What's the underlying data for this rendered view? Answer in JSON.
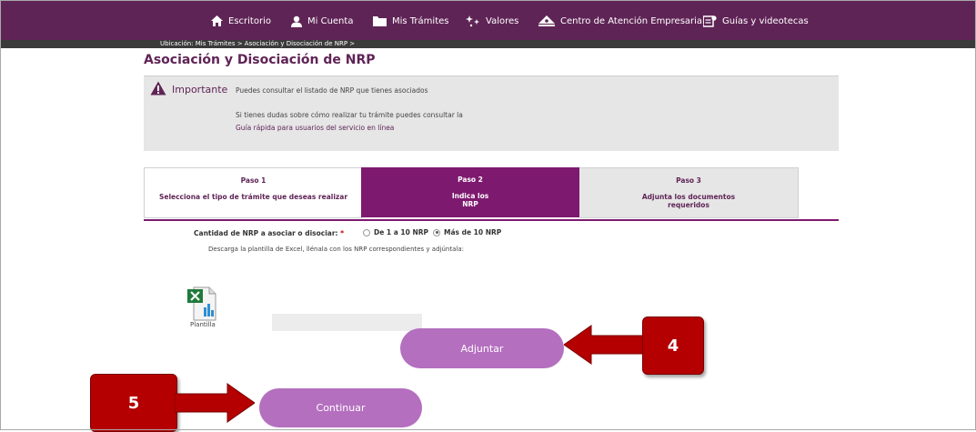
{
  "nav": {
    "items": [
      {
        "label": "Escritorio",
        "icon": "home-icon"
      },
      {
        "label": "Mi Cuenta",
        "icon": "user-icon"
      },
      {
        "label": "Mis Trámites",
        "icon": "folder-icon"
      },
      {
        "label": "Valores",
        "icon": "sparkle-icon"
      },
      {
        "label": "Centro de Atención Empresarial",
        "icon": "people-icon"
      },
      {
        "label": "Guías y videotecas",
        "icon": "guide-icon"
      }
    ]
  },
  "breadcrumb": "Ubicación: Mis Trámites > Asociación y Disociación de NRP >",
  "page_title": "Asociación y Disociación de NRP",
  "notice": {
    "heading": "Importante",
    "line1": "Puedes consultar el listado de NRP que tienes asociados",
    "line2": "Si tienes dudas sobre cómo realizar tu trámite puedes consultar la",
    "link": "Guía rápida para usuarios del servicio en línea"
  },
  "steps": [
    {
      "number": "Paso 1",
      "desc": "Selecciona el tipo de trámite que deseas realizar",
      "state": "done"
    },
    {
      "number": "Paso 2",
      "desc": "Indica los NRP",
      "state": "active"
    },
    {
      "number": "Paso 3",
      "desc": "Adjunta los documentos requeridos",
      "state": "pending"
    }
  ],
  "form": {
    "qty_label": "Cantidad de NRP a asociar o disociar:",
    "required_mark": "*",
    "options": [
      {
        "label": "De 1 a 10 NRP",
        "selected": false
      },
      {
        "label": "Más de 10 NRP",
        "selected": true
      }
    ],
    "hint": "Descarga la plantilla de Excel, llénala con los NRP correspondientes y adjúntala:",
    "template_label": "Plantilla",
    "file_value": ""
  },
  "buttons": {
    "attach": "Adjuntar",
    "continue": "Continuar"
  },
  "callouts": {
    "four": "4",
    "five": "5"
  },
  "colors": {
    "brand_purple": "#5f2456",
    "active_step": "#7d1a6f",
    "button": "#b46fbf",
    "callout_red": "#b40000"
  }
}
